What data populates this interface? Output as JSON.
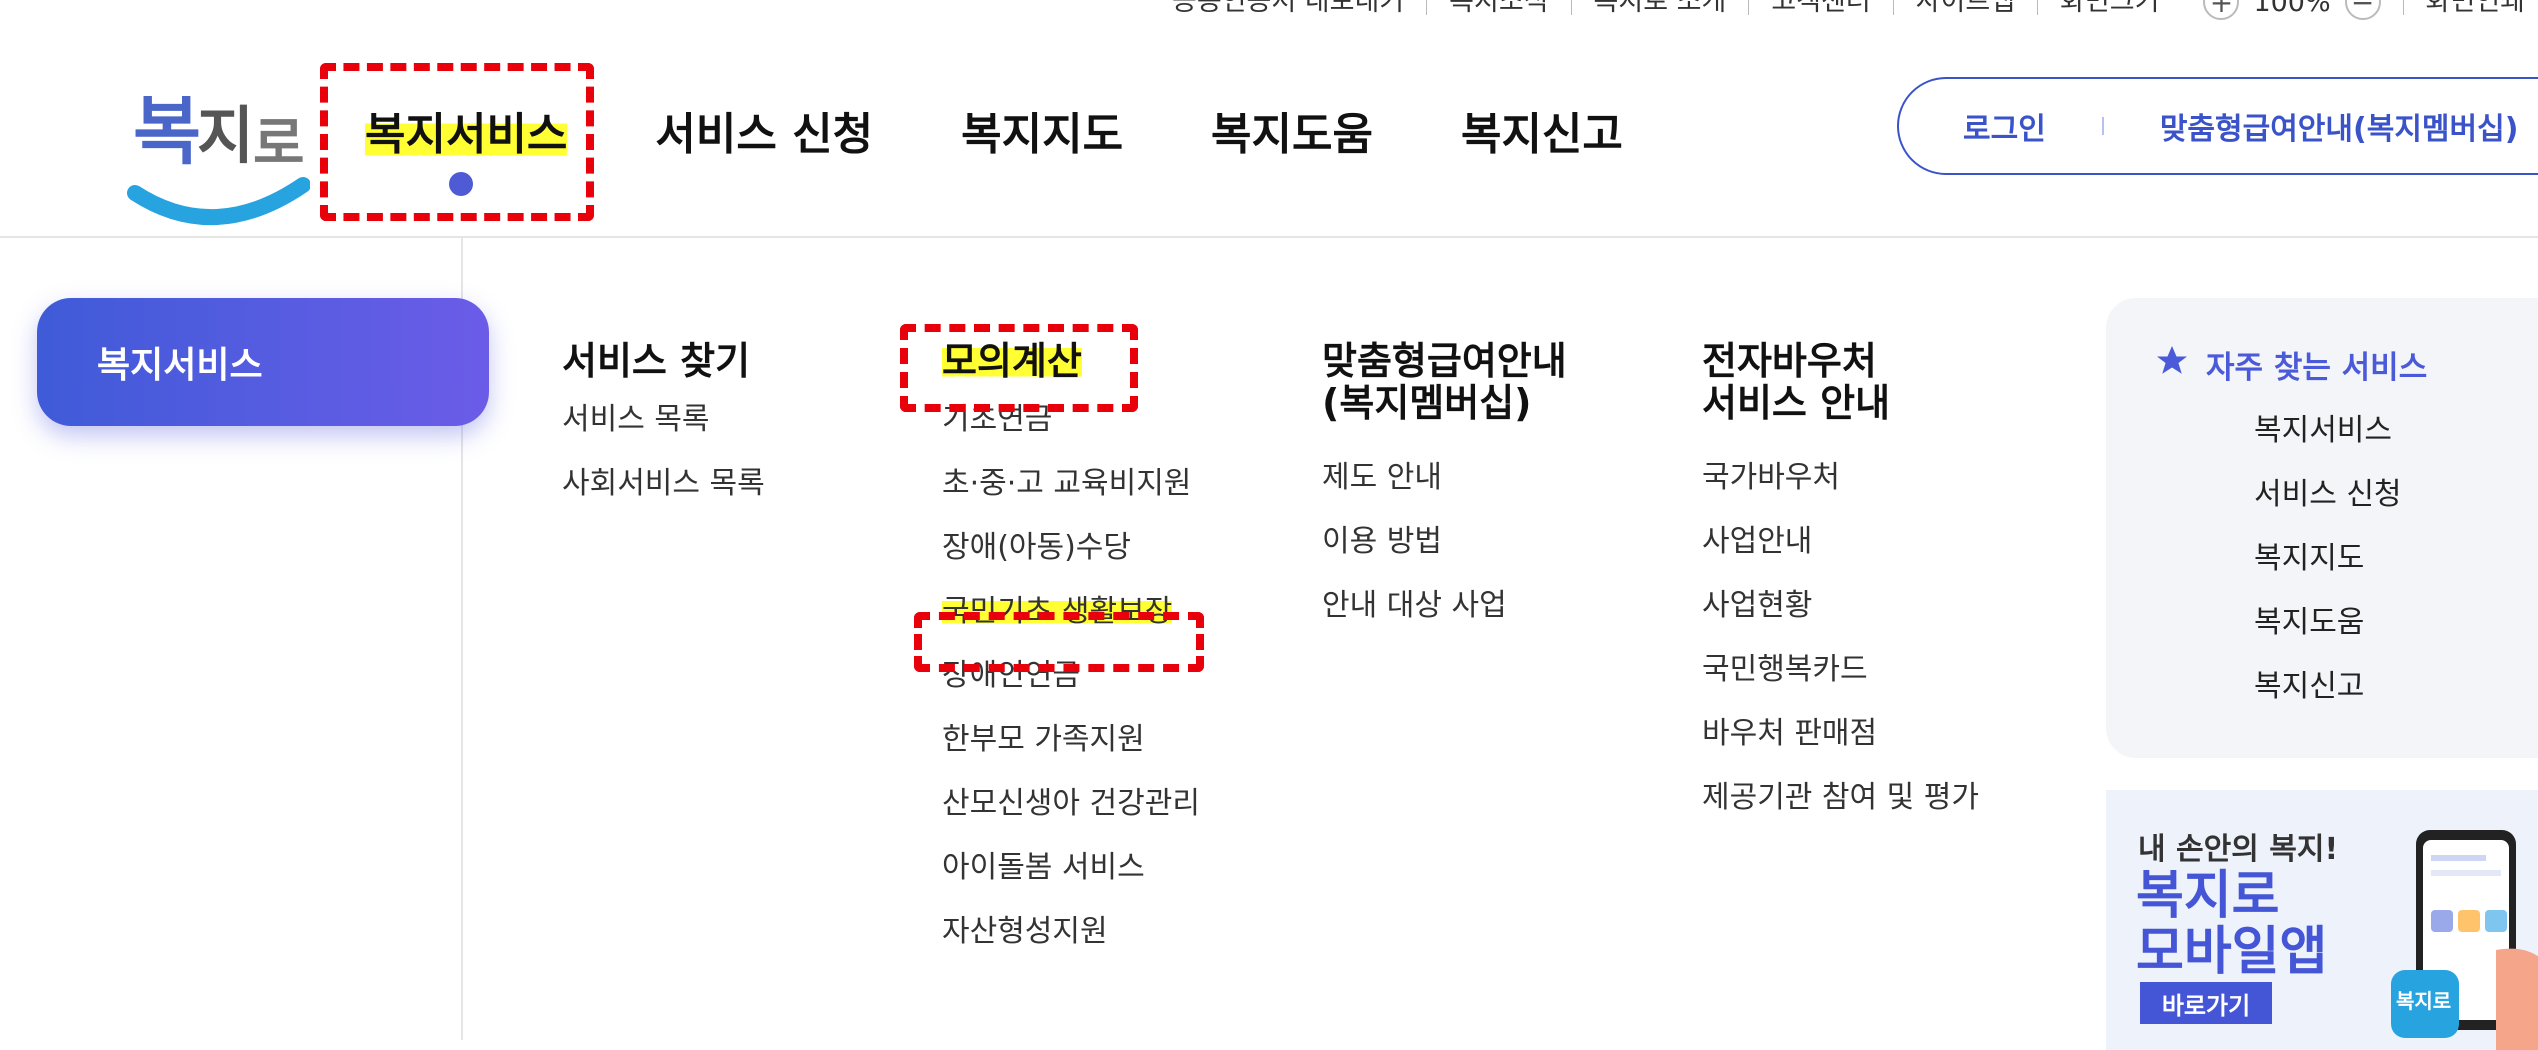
{
  "utility_bar": {
    "items": [
      "공동인증서 내보내기",
      "복지소식",
      "복지로 소개",
      "고객센터",
      "사이트맵",
      "화면크기"
    ],
    "zoom_value": "100%",
    "zoom_plus": "+",
    "zoom_minus": "−",
    "print": "화면인쇄"
  },
  "logo": {
    "alt": "복지로"
  },
  "nav": {
    "items": [
      "복지서비스",
      "서비스 신청",
      "복지지도",
      "복지도움",
      "복지신고"
    ]
  },
  "account": {
    "login": "로그인",
    "membership": "맞춤형급여안내(복지멤버십)"
  },
  "side": {
    "active_tab": "복지서비스"
  },
  "menu": {
    "col1": {
      "title": "서비스 찾기",
      "items": [
        "서비스 목록",
        "사회서비스 목록"
      ]
    },
    "col2": {
      "title": "모의계산",
      "items": [
        "기초연금",
        "초·중·고 교육비지원",
        "장애(아동)수당",
        "국민기초 생활보장",
        "장애인연금",
        "한부모 가족지원",
        "산모신생아 건강관리",
        "아이돌봄 서비스",
        "자산형성지원"
      ]
    },
    "col3": {
      "title_line1": "맞춤형급여안내",
      "title_line2": "(복지멤버십)",
      "items": [
        "제도 안내",
        "이용 방법",
        "안내 대상 사업"
      ]
    },
    "col4": {
      "title_line1": "전자바우처",
      "title_line2": "서비스 안내",
      "items": [
        "국가바우처",
        "사업안내",
        "사업현황",
        "국민행복카드",
        "바우처 판매점",
        "제공기관 참여 및 평가"
      ]
    }
  },
  "favorites": {
    "title": "자주 찾는 서비스",
    "items": [
      "복지서비스",
      "서비스 신청",
      "복지지도",
      "복지도움",
      "복지신고"
    ]
  },
  "banner": {
    "small": "내 손안의 복지!",
    "big_line1": "복지로",
    "big_line2": "모바일앱",
    "button": "바로가기",
    "phone_badge": "복지로"
  },
  "colors": {
    "accent": "#4456d6",
    "highlight": "#ffff33",
    "annotation": "#e8000b"
  }
}
